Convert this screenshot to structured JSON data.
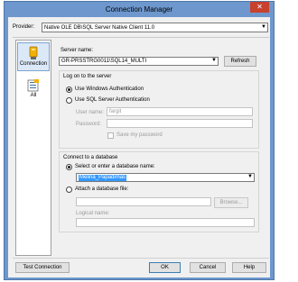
{
  "window": {
    "title": "Connection Manager",
    "close_glyph": "✕"
  },
  "provider": {
    "label": "Provider:",
    "value": "Native OLE DB\\SQL Server Native Client 11.0"
  },
  "nav": {
    "items": [
      {
        "label": "Connection",
        "icon": "connection-icon",
        "selected": true
      },
      {
        "label": "All",
        "icon": "all-properties-icon",
        "selected": false
      }
    ]
  },
  "server": {
    "label": "Server name:",
    "value": "GR-PRSSTRG0011\\SQL14_MULTI",
    "refresh_label": "Refresh"
  },
  "logon": {
    "group_title": "Log on to the server",
    "windows_auth_label": "Use Windows Authentication",
    "sql_auth_label": "Use SQL Server Authentication",
    "username_label": "User name:",
    "username_value": "fargit",
    "password_label": "Password:",
    "password_value": "",
    "save_password_label": "Save my password",
    "selected": "windows"
  },
  "database": {
    "group_title": "Connect to a database",
    "select_label": "Select or enter a database name:",
    "select_value": "Melina_Papadimas",
    "attach_label": "Attach a database file:",
    "attach_value": "",
    "browse_label": "Browse...",
    "logical_name_label": "Logical name:",
    "logical_name_value": "",
    "selected": "select"
  },
  "footer": {
    "test_connection_label": "Test Connection",
    "ok_label": "OK",
    "cancel_label": "Cancel",
    "help_label": "Help"
  },
  "colors": {
    "title_bar": "#6d97cd",
    "close_button": "#c7412f",
    "selection": "#3399ff"
  }
}
